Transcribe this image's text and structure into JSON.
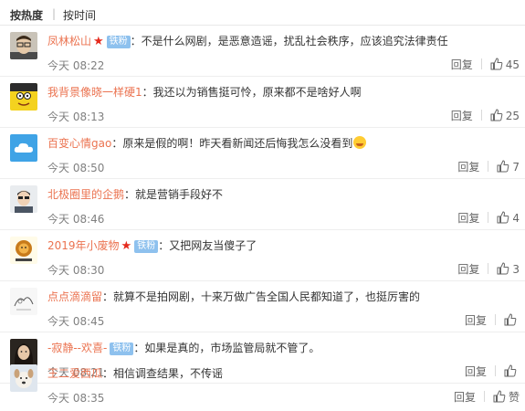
{
  "sort": {
    "hot_label": "按热度",
    "time_label": "按时间",
    "separator": "|"
  },
  "colors": {
    "username": "#eb7350",
    "badge": "#8ec1ee",
    "star": "#e52a1d",
    "meta": "#808080"
  },
  "comments": [
    {
      "username": "凤林松山",
      "star": true,
      "badge": "铁粉",
      "text": "：不是什么网剧，是恶意造谣，扰乱社会秩序，应该追究法律责任",
      "time": "今天 08:22",
      "reply": "回复",
      "likes": "45",
      "avatar_icon": "man-glasses-avatar-icon"
    },
    {
      "username": "我背景像晓一样硬1",
      "star": false,
      "badge": "",
      "text": "：我还以为销售挺可怜，原来都不是啥好人啊",
      "time": "今天 08:13",
      "reply": "回复",
      "likes": "25",
      "avatar_icon": "cartoon-avatar-icon"
    },
    {
      "username": "百变心情gao",
      "star": false,
      "badge": "",
      "text": "：原来是假的啊！昨天看新闻还后悔我怎么没看到",
      "emoji": true,
      "time": "今天 08:50",
      "reply": "回复",
      "likes": "7",
      "avatar_icon": "cloud-avatar-icon"
    },
    {
      "username": "北极圈里的企鹅",
      "star": false,
      "badge": "",
      "text": "：就是营销手段好不",
      "time": "今天 08:46",
      "reply": "回复",
      "likes": "4",
      "avatar_icon": "person-avatar-icon"
    },
    {
      "username": "2019年小废物",
      "star": true,
      "badge": "铁粉",
      "text": "：又把网友当傻子了",
      "time": "今天 08:30",
      "reply": "回复",
      "likes": "3",
      "avatar_icon": "lion-avatar-icon"
    },
    {
      "username": "点点滴滴留",
      "star": false,
      "badge": "",
      "text": "：就算不是拍网剧，十来万做广告全国人民都知道了，也挺厉害的",
      "time": "今天 08:45",
      "reply": "回复",
      "likes": "",
      "avatar_icon": "sketch-avatar-icon"
    },
    {
      "username": "-寂静--欢喜-",
      "star": false,
      "badge": "铁粉",
      "text": "：如果是真的，市场监管局就不管了。",
      "time": "今天 08:21",
      "reply": "回复",
      "likes": "",
      "avatar_icon": "woman-avatar-icon"
    },
    {
      "username": "王二爱西瓜",
      "star": false,
      "badge": "",
      "text": "：相信调查结果，不传谣",
      "time": "今天 08:35",
      "reply": "回复",
      "likes": "赞",
      "avatar_icon": "dog-avatar-icon"
    }
  ]
}
